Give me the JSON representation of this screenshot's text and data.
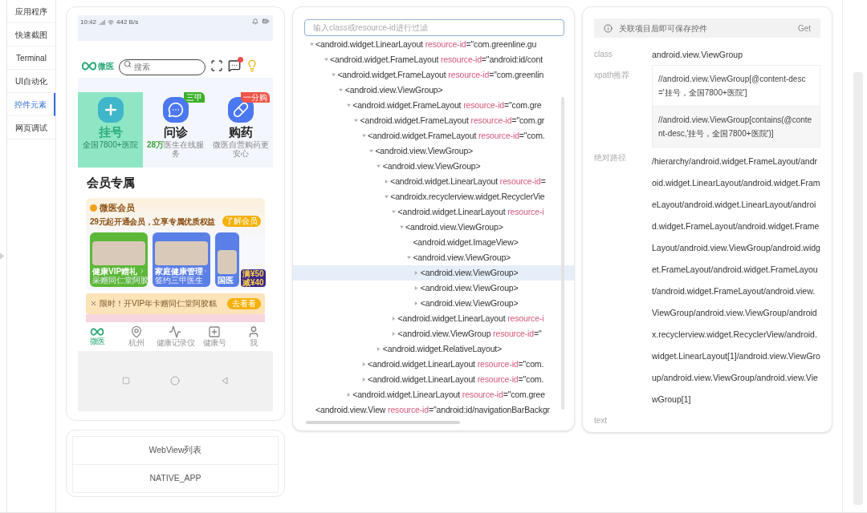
{
  "sidebar": {
    "items": [
      {
        "label": "应用程序",
        "selected": false
      },
      {
        "label": "快速截图",
        "selected": false
      },
      {
        "label": "Terminal",
        "selected": false
      },
      {
        "label": "UI自动化",
        "selected": false
      },
      {
        "label": "控件元素",
        "selected": true
      },
      {
        "label": "网页调试",
        "selected": false
      }
    ]
  },
  "phone": {
    "status_bar": {
      "time": "10:42",
      "speed": "442 B/s"
    },
    "logo": "微医",
    "search": {
      "placeholder": "搜索"
    },
    "tiles": [
      {
        "kind": "register",
        "title": "挂号",
        "subtitle": "全国7800+医院",
        "selected": true
      },
      {
        "kind": "consult",
        "title": "问诊",
        "subtitle": "**28万**医生在线服务",
        "badge": "三甲",
        "color": "#3cb12c",
        "selected": false
      },
      {
        "kind": "pharmacy",
        "title": "购药",
        "subtitle": "微医自营购药更安心",
        "badge": "一分购",
        "color": "#f0554a",
        "selected": false
      }
    ],
    "section_title": "会员专属",
    "member": {
      "title": "微医会员",
      "subtitle": "29元起开通会员，立享专属优质权益",
      "button": "了解会员",
      "cards": [
        {
          "title": "健康VIP赠礼",
          "subtitle": "采赠同仁堂阿胶",
          "color": "#5cb837"
        },
        {
          "title": "家庭健康管理",
          "subtitle": "签约三甲医生",
          "color": "#5a7fe6"
        },
        {
          "title": "国医",
          "color": "#5a7fe6"
        }
      ],
      "sticker": {
        "line_1": "满¥50",
        "line_2": "减¥40"
      }
    },
    "banner": {
      "text": "限时！开VIP年卡赠同仁堂阿胶糕",
      "button": "去看看"
    },
    "nav": [
      {
        "kind": "home",
        "label": "微医",
        "selected": true
      },
      {
        "kind": "location",
        "label": "杭州",
        "selected": false
      },
      {
        "kind": "pulse",
        "label": "健康记录仪",
        "selected": false
      },
      {
        "kind": "plus",
        "label": "健康号",
        "selected": false
      },
      {
        "kind": "person",
        "label": "我",
        "selected": false
      }
    ]
  },
  "webview": {
    "title": "WebView列表",
    "items": [
      "NATIVE_APP"
    ]
  },
  "tree": {
    "filter": {
      "placeholder": "输入class或resource-id进行过滤"
    },
    "nodes": [
      {
        "tag": "<android.widget.LinearLayout",
        "attr": "resource-id",
        "value": "=\"com.greenline.gu",
        "expanded": true,
        "selected": false,
        "children": [
          {
            "tag": "<android.widget.FrameLayout",
            "attr": "resource-id",
            "value": "=\"android:id/cont",
            "expanded": true,
            "selected": false,
            "children": [
              {
                "tag": "<android.widget.FrameLayout",
                "attr": "resource-id",
                "value": "=\"com.greenlin",
                "expanded": true,
                "selected": false,
                "children": [
                  {
                    "tag": "<android.view.ViewGroup>",
                    "expanded": true,
                    "selected": false,
                    "children": [
                      {
                        "tag": "<android.widget.FrameLayout",
                        "attr": "resource-id",
                        "value": "=\"com.gre",
                        "expanded": true,
                        "selected": false,
                        "children": [
                          {
                            "tag": "<android.widget.FrameLayout",
                            "attr": "resource-id",
                            "value": "=\"com.gr",
                            "expanded": true,
                            "selected": false,
                            "children": [
                              {
                                "tag": "<android.widget.FrameLayout",
                                "attr": "resource-id",
                                "value": "=\"com.",
                                "expanded": true,
                                "selected": false,
                                "children": [
                                  {
                                    "tag": "<android.view.ViewGroup>",
                                    "expanded": true,
                                    "selected": false,
                                    "children": [
                                      {
                                        "tag": "<android.view.ViewGroup>",
                                        "expanded": true,
                                        "selected": false,
                                        "children": [
                                          {
                                            "tag": "<android.widget.LinearLayout",
                                            "attr": "resource-id",
                                            "value": "=",
                                            "expanded": false,
                                            "selected": false
                                          },
                                          {
                                            "tag": "<androidx.recyclerview.widget.RecyclerVie",
                                            "expanded": true,
                                            "selected": false,
                                            "children": [
                                              {
                                                "tag": "<android.widget.LinearLayout",
                                                "attr": "resource-i",
                                                "expanded": true,
                                                "selected": false,
                                                "children": [
                                                  {
                                                    "tag": "<android.view.ViewGroup>",
                                                    "expanded": true,
                                                    "selected": false,
                                                    "children": [
                                                      {
                                                        "tag": "<android.widget.ImageView>",
                                                        "selected": false
                                                      },
                                                      {
                                                        "tag": "<android.view.ViewGroup>",
                                                        "expanded": true,
                                                        "selected": false,
                                                        "children": [
                                                          {
                                                            "tag": "<android.view.ViewGroup>",
                                                            "expanded": false,
                                                            "selected": true
                                                          },
                                                          {
                                                            "tag": "<android.view.ViewGroup>",
                                                            "expanded": false,
                                                            "selected": false
                                                          },
                                                          {
                                                            "tag": "<android.view.ViewGroup>",
                                                            "expanded": false,
                                                            "selected": false
                                                          }
                                                        ]
                                                      }
                                                    ]
                                                  }
                                                ]
                                              },
                                              {
                                                "tag": "<android.widget.LinearLayout",
                                                "attr": "resource-i",
                                                "expanded": false,
                                                "selected": false
                                              },
                                              {
                                                "tag": "<android.view.ViewGroup",
                                                "attr": "resource-id",
                                                "value": "=\"",
                                                "expanded": false,
                                                "selected": false
                                              }
                                            ]
                                          }
                                        ]
                                      },
                                      {
                                        "tag": "<android.widget.RelativeLayout>",
                                        "expanded": false,
                                        "selected": false
                                      }
                                    ]
                                  }
                                ]
                              },
                              {
                                "tag": "<android.widget.LinearLayout",
                                "attr": "resource-id",
                                "value": "=\"com.",
                                "expanded": false,
                                "selected": false
                              },
                              {
                                "tag": "<android.widget.LinearLayout",
                                "attr": "resource-id",
                                "value": "=\"com.",
                                "expanded": false,
                                "selected": false
                              }
                            ]
                          }
                        ]
                      },
                      {
                        "tag": "<android.widget.LinearLayout",
                        "attr": "resource-id",
                        "value": "=\"com.gree",
                        "expanded": false,
                        "selected": false
                      }
                    ]
                  }
                ]
              }
            ]
          }
        ]
      },
      {
        "tag": "<android.view.View",
        "attr": "resource-id",
        "value": "=\"android:id/navigationBarBackgr",
        "selected": false
      }
    ]
  },
  "details": {
    "notice": "关联项目后即可保存控件",
    "get_button": {
      "label": "Get",
      "disabled": true
    },
    "fields": [
      {
        "kind": "text",
        "label": "class",
        "value": "android.view.ViewGroup"
      },
      {
        "kind": "list",
        "label": "xpath推荐",
        "values": [
          "//android.view.ViewGroup[@content-desc='挂号，全国7800+医院']",
          "//android.view.ViewGroup[contains(@content-desc,'挂号，全国7800+医院')]"
        ]
      },
      {
        "kind": "path",
        "label": "绝对路径",
        "value": "/hierarchy/android.widget.FrameLayout/android.widget.LinearLayout/android.widget.FrameLayout/android.widget.LinearLayout/android.widget.FrameLayout/android.widget.FrameLayout/android.view.ViewGroup/android.widget.FrameLayout/android.widget.FrameLayout/android.widget.FrameLayout/android.view.ViewGroup/android.view.ViewGroup/androidx.recyclerview.widget.RecyclerView/android.widget.LinearLayout[1]/android.view.ViewGroup/android.view.ViewGroup/android.view.ViewGroup[1]"
      },
      {
        "kind": "text",
        "label": "text"
      }
    ]
  }
}
